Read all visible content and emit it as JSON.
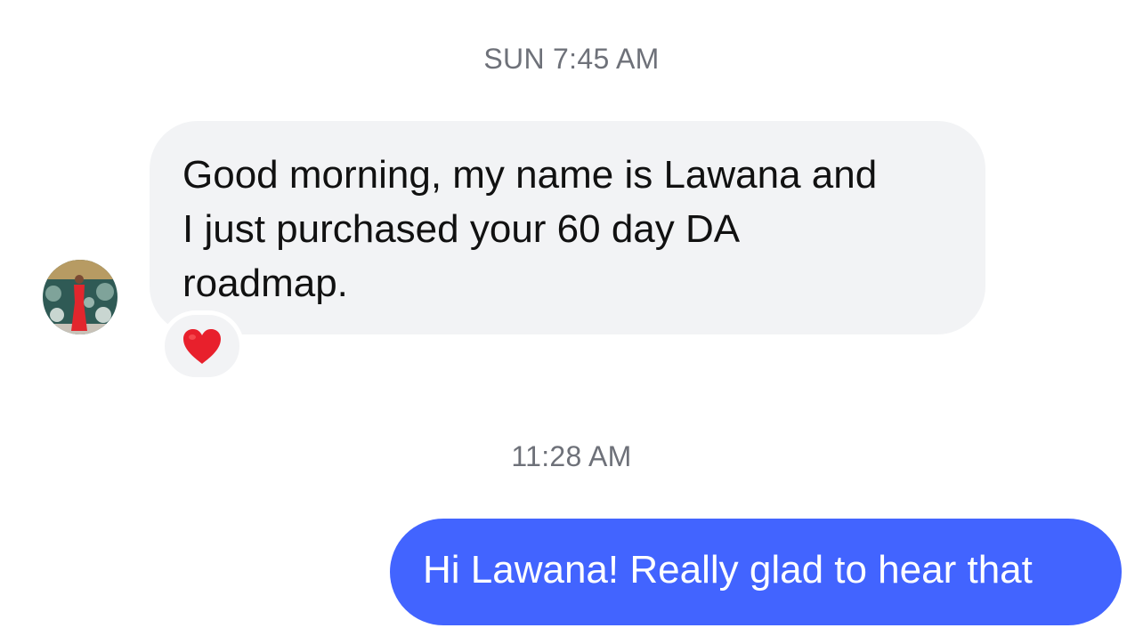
{
  "timestamps": {
    "first": "SUN 7:45 AM",
    "second": "11:28 AM"
  },
  "incoming": {
    "avatar": "profile-photo-avatar",
    "lines": [
      "Good morning, my name is Lawana and",
      "I just purchased your 60 day DA",
      "roadmap."
    ],
    "reaction": "heart-emoji"
  },
  "outgoing": {
    "text": "Hi Lawana! Really glad to hear that"
  },
  "colors": {
    "incoming_bubble": "#f2f3f5",
    "outgoing_bubble": "#4264ff",
    "timestamp_text": "#6e7179",
    "heart": "#e8202c"
  }
}
